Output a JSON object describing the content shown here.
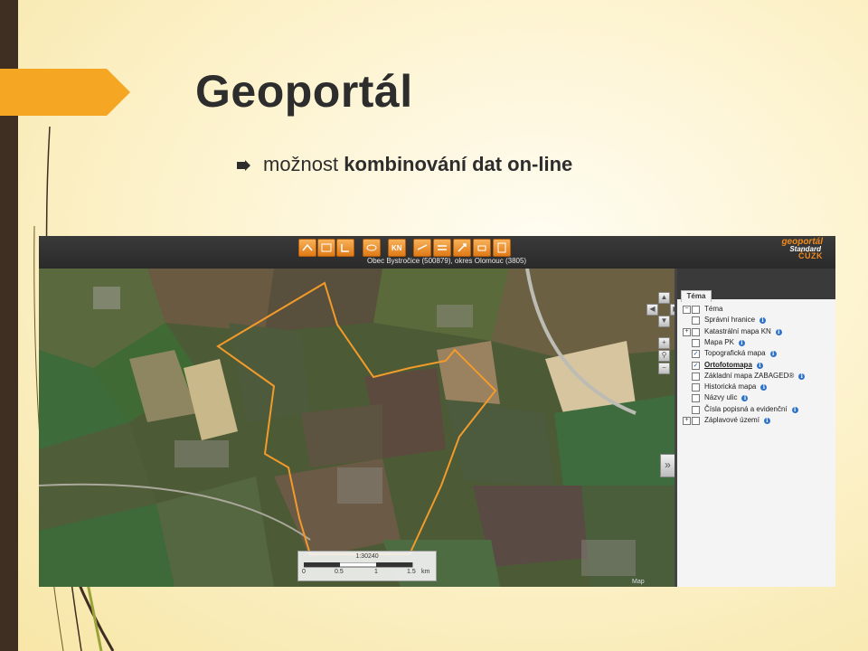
{
  "slide": {
    "title": "Geoportál",
    "bullet_plain": "možnost ",
    "bullet_bold": "kombinování dat on-line",
    "accent_color": "#f5a623"
  },
  "app": {
    "location_text": "Obec Bystročice (500879), okres Olomouc (3805)",
    "toolbar_buttons": [
      "move-icon",
      "select-icon",
      "measure-icon",
      "draw-icon",
      "kn-button",
      "layers-icon",
      "legend-icon",
      "tools-icon",
      "print-icon",
      "save-icon"
    ],
    "kn_label": "KN",
    "brand": {
      "top": "geoportál",
      "middle": "Standard",
      "bottom": "ČÚZK"
    },
    "scale": {
      "ratio": "1:30240",
      "ticks": [
        "0",
        "0.5",
        "1",
        "1.5",
        "km"
      ]
    },
    "collapse_label": "»",
    "map_credit": "Map",
    "panel": {
      "tab_label": "Téma",
      "layers": [
        {
          "label": "Téma",
          "expand": "−",
          "checked": false,
          "info": false
        },
        {
          "label": "Správní hranice",
          "expand": "",
          "checked": false,
          "info": true
        },
        {
          "label": "Katastrální mapa KN",
          "expand": "+",
          "checked": false,
          "info": true
        },
        {
          "label": "Mapa PK",
          "expand": "",
          "checked": false,
          "info": true
        },
        {
          "label": "Topografická mapa",
          "expand": "",
          "checked": true,
          "info": true
        },
        {
          "label": "Ortofotomapa",
          "expand": "",
          "checked": true,
          "info": true,
          "active": true
        },
        {
          "label": "Základní mapa ZABAGED®",
          "expand": "",
          "checked": false,
          "info": true
        },
        {
          "label": "Historická mapa",
          "expand": "",
          "checked": false,
          "info": true
        },
        {
          "label": "Názvy ulic",
          "expand": "",
          "checked": false,
          "info": true
        },
        {
          "label": "Čísla popisná a evidenční",
          "expand": "",
          "checked": false,
          "info": true
        },
        {
          "label": "Záplavové území",
          "expand": "+",
          "checked": false,
          "info": true
        }
      ]
    }
  }
}
